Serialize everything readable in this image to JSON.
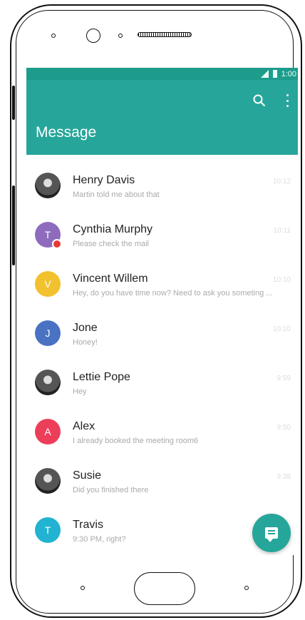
{
  "status_bar": {
    "time": "1:00"
  },
  "header": {
    "title": "Message"
  },
  "colors": {
    "primary": "#26a69a",
    "status_bar": "#1d9c8c"
  },
  "conversations": [
    {
      "name": "Henry Davis",
      "preview": "Martin told me about that",
      "time": "10:12",
      "avatar_type": "photo"
    },
    {
      "name": "Cynthia Murphy",
      "preview": "Please check the mail",
      "time": "10:11",
      "avatar_letter": "T",
      "avatar_color": "#8e6bbd",
      "unread": true
    },
    {
      "name": "Vincent Willem",
      "preview": "Hey, do you have time now? Need to ask you someting ...",
      "time": "10:10",
      "avatar_letter": "V",
      "avatar_color": "#f2c12e"
    },
    {
      "name": "Jone",
      "preview": "Honey!",
      "time": "10:10",
      "avatar_letter": "J",
      "avatar_color": "#4a72c2"
    },
    {
      "name": "Lettie Pope",
      "preview": "Hey",
      "time": "9:59",
      "avatar_type": "photo"
    },
    {
      "name": "Alex",
      "preview": "I already booked the meeting room6",
      "time": "9:50",
      "avatar_letter": "A",
      "avatar_color": "#ec3e59"
    },
    {
      "name": "Susie",
      "preview": "Did you finished there",
      "time": "9:38",
      "avatar_type": "photo"
    },
    {
      "name": "Travis",
      "preview": "9:30 PM, right?",
      "time": "",
      "avatar_letter": "T",
      "avatar_color": "#21b3d1"
    }
  ],
  "icons": {
    "search": "search-icon",
    "more": "more-vert-icon",
    "fab": "chat-icon"
  }
}
